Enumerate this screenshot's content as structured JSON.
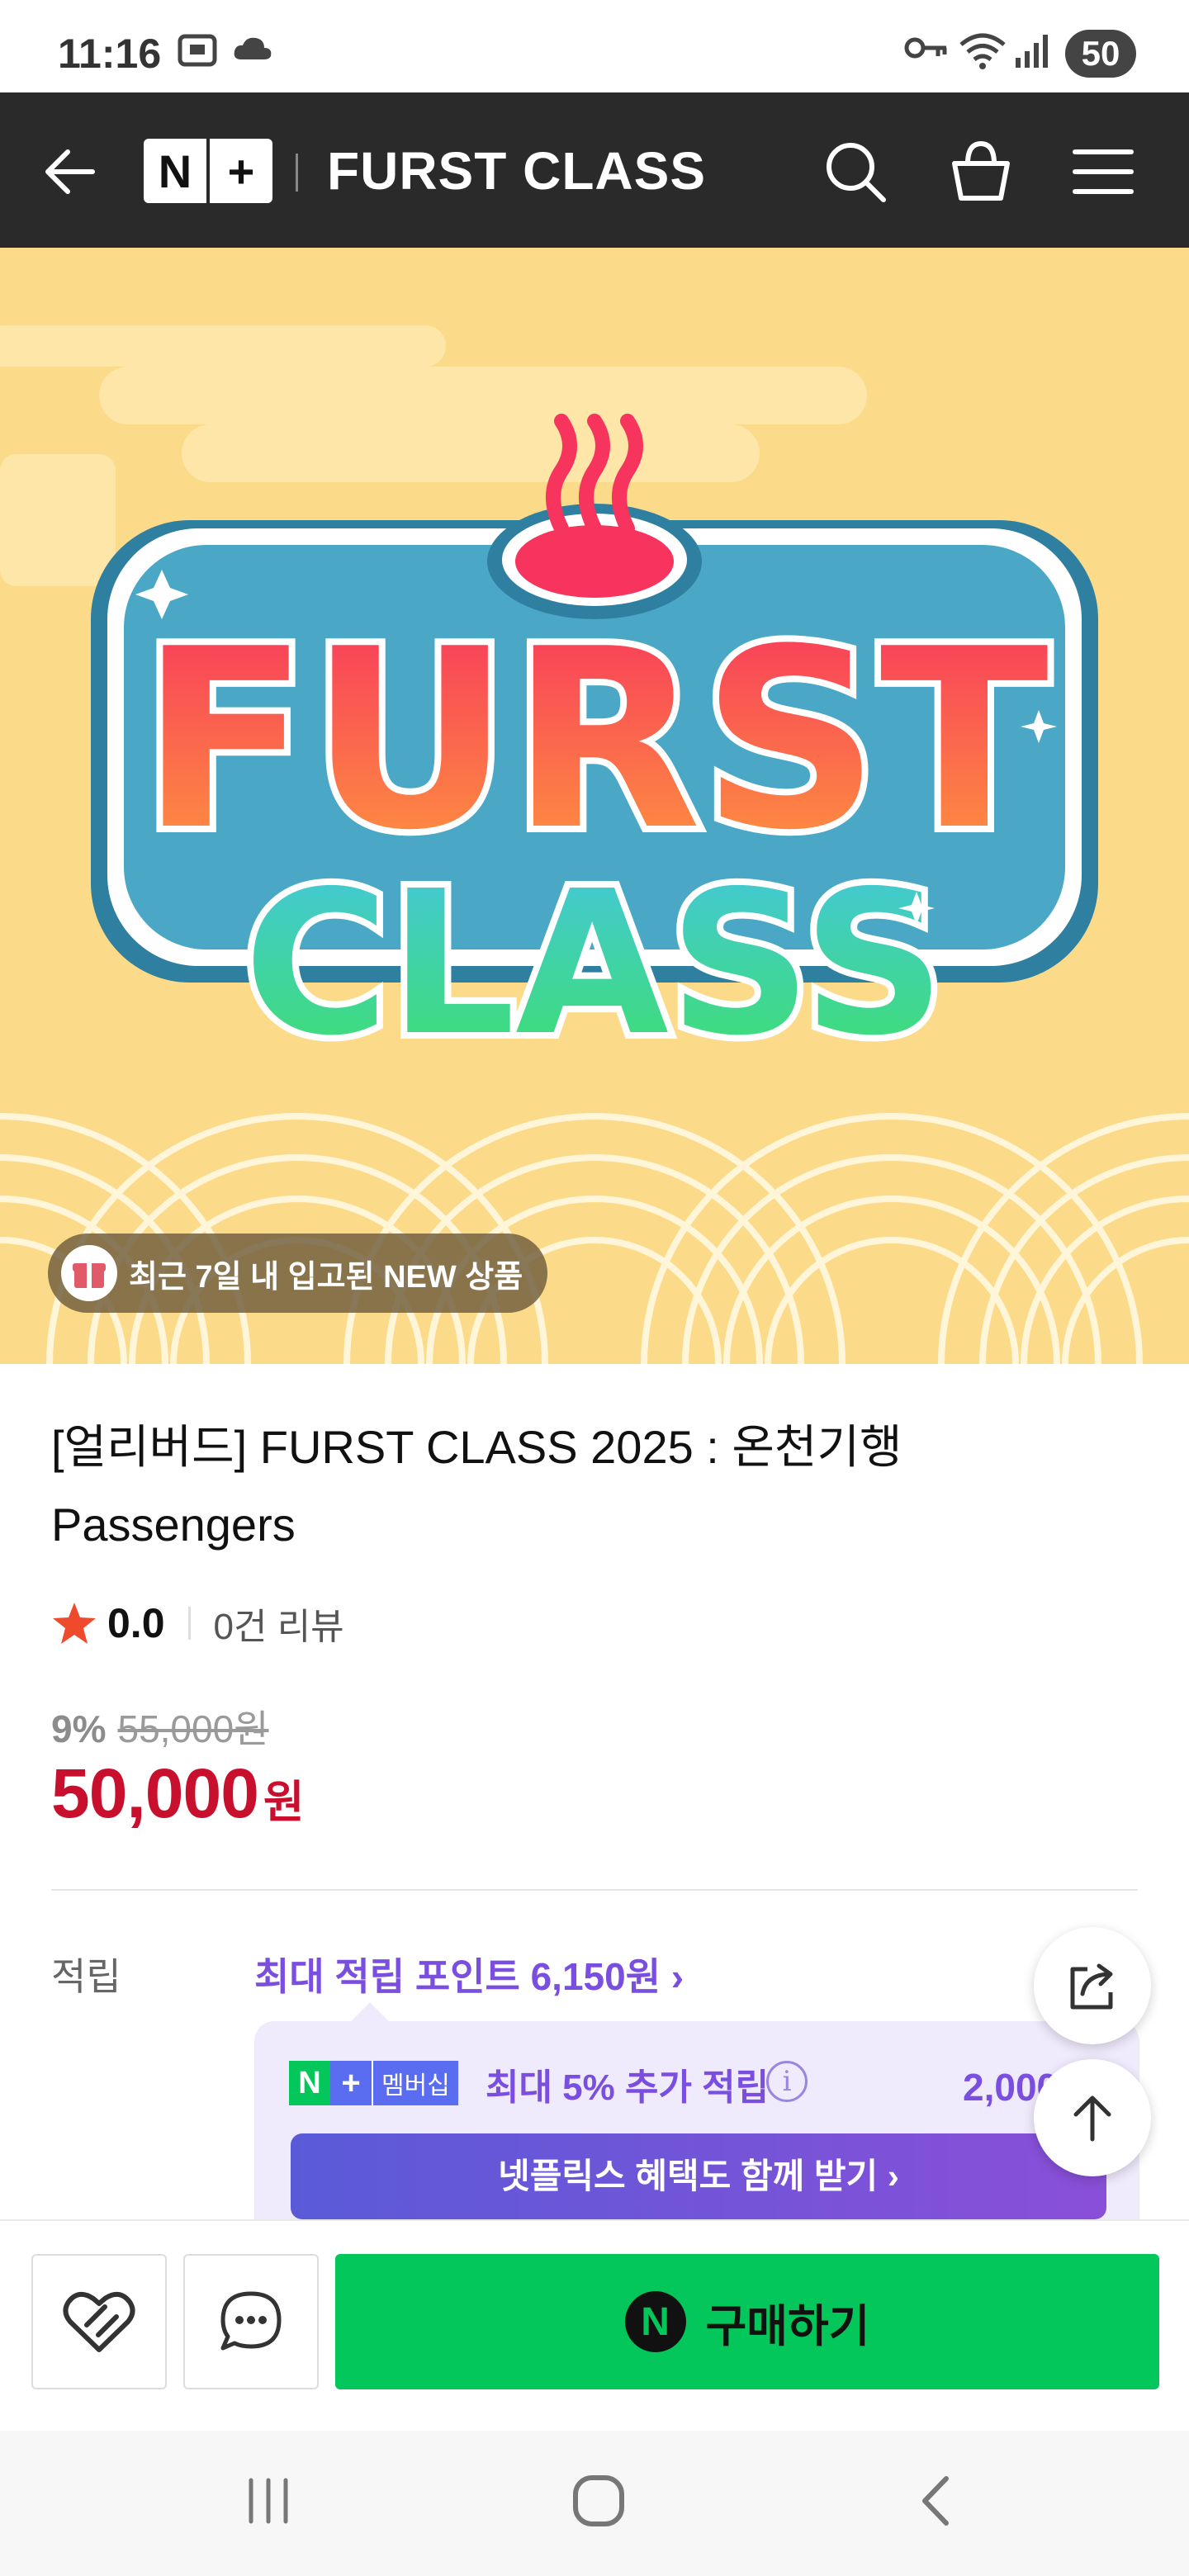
{
  "status_bar": {
    "time": "11:16",
    "battery": "50"
  },
  "header": {
    "brand": "FURST CLASS",
    "logo_left": "N",
    "logo_right": "+"
  },
  "hero": {
    "logo_word_1": "FURST",
    "logo_word_2": "CLASS",
    "badge_text": "최근 7일 내 입고된 NEW 상품"
  },
  "product": {
    "title_line1": "[얼리버드] FURST CLASS 2025 : 온천기행",
    "title_line2": "Passengers",
    "rating": "0.0",
    "review_count": "0건 리뷰",
    "discount_percent": "9%",
    "original_price": "55,000원",
    "price": "50,000",
    "currency": "원"
  },
  "points": {
    "label": "적립",
    "max_points_link": "최대 적립 포인트 6,150원 ›",
    "membership_n": "N",
    "membership_plus": "+",
    "membership_label": "멤버십",
    "membership_text": "최대 5% 추가 적립",
    "info_icon": "i",
    "membership_amount": "2,000원",
    "netflix_button": "넷플릭스 혜택도 함께 받기 ›"
  },
  "actions": {
    "buy_label": "구매하기",
    "buy_mark": "N"
  },
  "colors": {
    "brand_green": "#03c75a",
    "price_red": "#c8102e",
    "accent_purple": "#7a4fe0",
    "header_dark": "#2a2a2a"
  }
}
